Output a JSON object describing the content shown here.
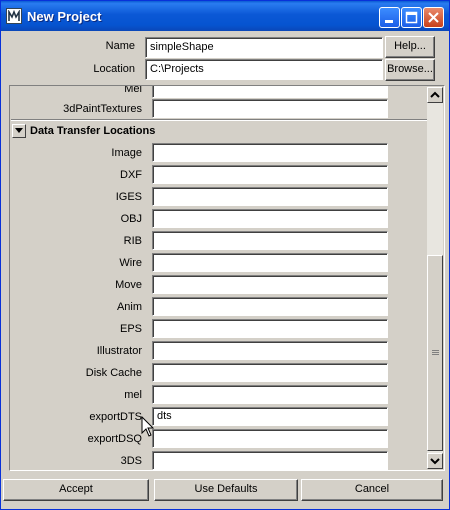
{
  "window": {
    "title": "New Project"
  },
  "form": {
    "name_label": "Name",
    "name_value": "simpleShape",
    "location_label": "Location",
    "location_value": "C:\\Projects",
    "help_button": "Help...",
    "browse_button": "Browse..."
  },
  "partial_rows": [
    {
      "label": "Mel",
      "value": ""
    },
    {
      "label": "3dPaintTextures",
      "value": ""
    }
  ],
  "section": {
    "title": "Data Transfer Locations",
    "rows": [
      {
        "label": "Image",
        "value": ""
      },
      {
        "label": "DXF",
        "value": ""
      },
      {
        "label": "IGES",
        "value": ""
      },
      {
        "label": "OBJ",
        "value": ""
      },
      {
        "label": "RIB",
        "value": ""
      },
      {
        "label": "Wire",
        "value": ""
      },
      {
        "label": "Move",
        "value": ""
      },
      {
        "label": "Anim",
        "value": ""
      },
      {
        "label": "EPS",
        "value": ""
      },
      {
        "label": "Illustrator",
        "value": ""
      },
      {
        "label": "Disk Cache",
        "value": ""
      },
      {
        "label": "mel",
        "value": ""
      },
      {
        "label": "exportDTS",
        "value": "dts"
      },
      {
        "label": "exportDSQ",
        "value": ""
      },
      {
        "label": "3DS",
        "value": ""
      }
    ]
  },
  "footer": {
    "accept": "Accept",
    "use_defaults": "Use Defaults",
    "cancel": "Cancel"
  }
}
